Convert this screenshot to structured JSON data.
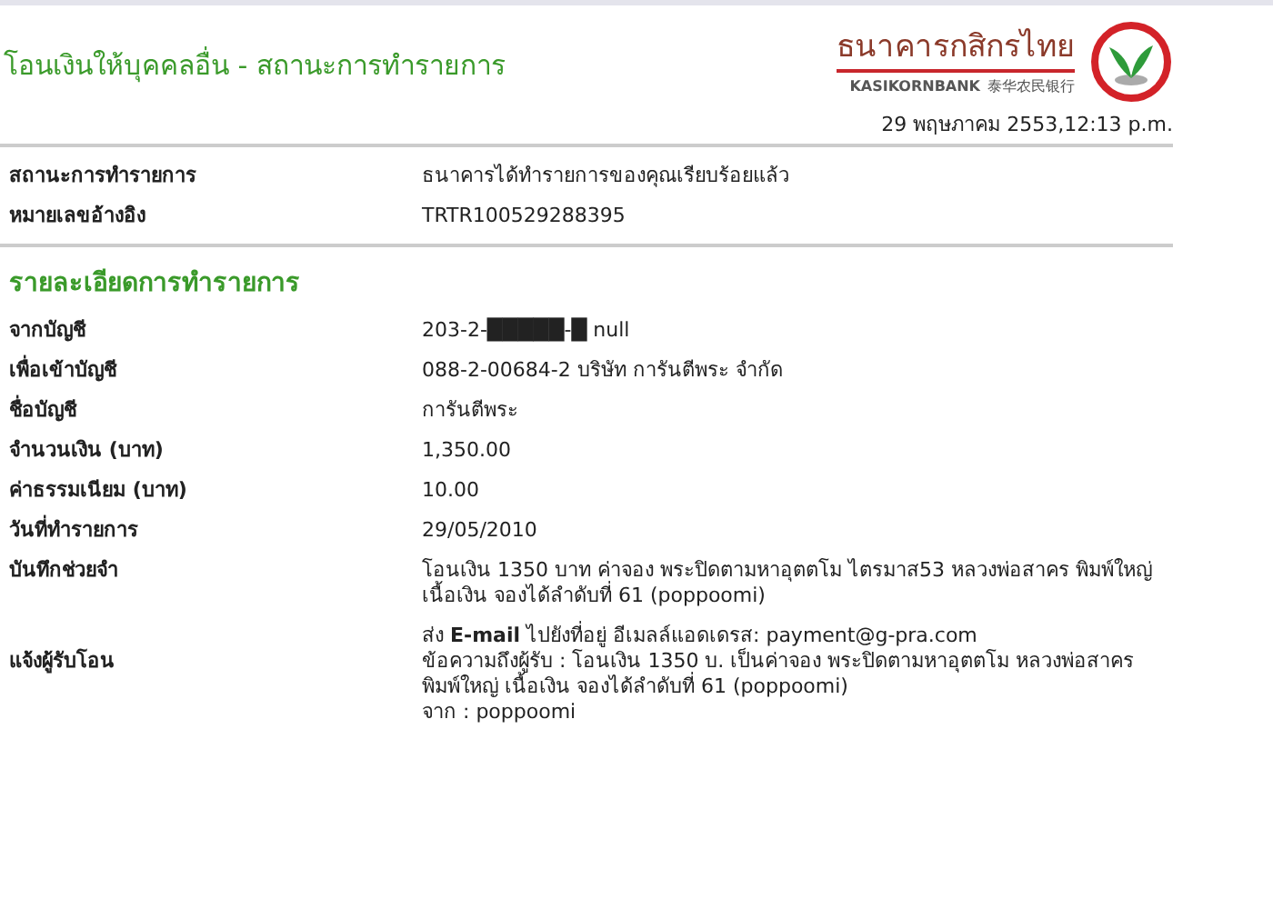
{
  "page_title": "โอนเงินให้บุคคลอื่น - สถานะการทำรายการ",
  "logo": {
    "thai_name": "ธนาคารกสิกรไทย",
    "english_name": "KASIKORNBANK",
    "chinese_name": "泰华农民银行"
  },
  "timestamp": "29 พฤษภาคม 2553,12:13 p.m.",
  "status_rows": [
    {
      "label": "สถานะการทำรายการ",
      "value": "ธนาคารได้ทำรายการของคุณเรียบร้อยแล้ว"
    },
    {
      "label": "หมายเลขอ้างอิง",
      "value": "TRTR100529288395"
    }
  ],
  "details_title": "รายละเอียดการทำรายการ",
  "detail_rows": [
    {
      "label": "จากบัญชี",
      "lines": [
        "203-2-█████-█ null"
      ]
    },
    {
      "label": "เพื่อเข้าบัญชี",
      "lines": [
        "088-2-00684-2 บริษัท การันตีพระ จำกัด"
      ]
    },
    {
      "label": "ชื่อบัญชี",
      "lines": [
        "การันตีพระ"
      ]
    },
    {
      "label": "จำนวนเงิน (บาท)",
      "lines": [
        "1,350.00"
      ]
    },
    {
      "label": "ค่าธรรมเนียม (บาท)",
      "lines": [
        "10.00"
      ]
    },
    {
      "label": "วันที่ทำรายการ",
      "lines": [
        "29/05/2010"
      ]
    },
    {
      "label": "บันทึกช่วยจำ",
      "lines": [
        "โอนเงิน 1350 บาท ค่าจอง พระปิดตามหาอุตตโม ไตรมาส53 หลวงพ่อสาคร พิมพ์ใหญ่เนื้อเงิน จองได้ลำดับที่ 61 (poppoomi)"
      ]
    },
    {
      "label": "แจ้งผู้รับโอน",
      "lines": [
        "ส่ง **E-mail** ไปยังที่อยู่ อีเมลล์แอดเดรส: payment@g-pra.com",
        "ข้อความถึงผู้รับ : โอนเงิน 1350 บ. เป็นค่าจอง พระปิดตามหาอุตตโม หลวงพ่อสาคร พิมพ์ใหญ่ เนื้อเงิน จองได้ลำดับที่ 61 (poppoomi)",
        "จาก : poppoomi"
      ]
    }
  ]
}
